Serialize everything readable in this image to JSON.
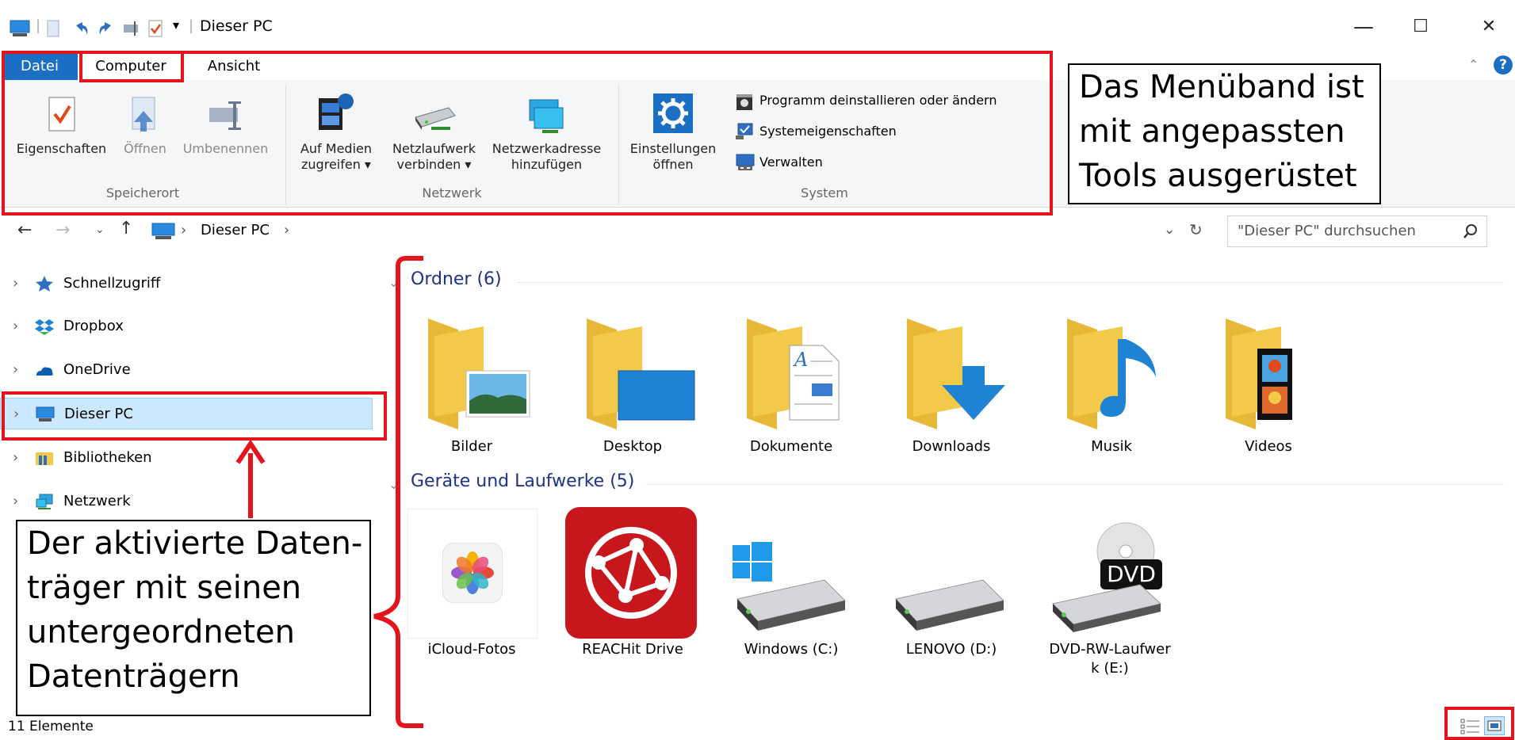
{
  "window": {
    "title": "Dieser PC",
    "minimize": "—",
    "maximize": "☐",
    "close": "✕"
  },
  "tabs": {
    "datei": "Datei",
    "computer": "Computer",
    "ansicht": "Ansicht"
  },
  "ribbon": {
    "speicherort": {
      "group_label": "Speicherort",
      "eigenschaften": "Eigenschaften",
      "oeffnen": "Öffnen",
      "umbenennen": "Umbenennen"
    },
    "netzwerk": {
      "group_label": "Netzwerk",
      "auf_medien_line1": "Auf Medien",
      "auf_medien_line2": "zugreifen ▾",
      "netzlaufwerk_line1": "Netzlaufwerk",
      "netzlaufwerk_line2": "verbinden ▾",
      "netzwerkadresse_line1": "Netzwerkadresse",
      "netzwerkadresse_line2": "hinzufügen"
    },
    "system": {
      "group_label": "System",
      "einstellungen_line1": "Einstellungen",
      "einstellungen_line2": "öffnen",
      "programm": "Programm deinstallieren oder ändern",
      "systemeigenschaften": "Systemeigenschaften",
      "verwalten": "Verwalten"
    }
  },
  "address": {
    "breadcrumb_root": "Dieser PC",
    "sep1": "›",
    "sep2": "›",
    "search_placeholder": "\"Dieser PC\" durchsuchen"
  },
  "nav": {
    "items": [
      {
        "label": "Schnellzugriff"
      },
      {
        "label": "Dropbox"
      },
      {
        "label": "OneDrive"
      },
      {
        "label": "Dieser PC"
      },
      {
        "label": "Bibliotheken"
      },
      {
        "label": "Netzwerk"
      }
    ]
  },
  "content": {
    "folders_header": "Ordner (6)",
    "folders": [
      {
        "label": "Bilder"
      },
      {
        "label": "Desktop"
      },
      {
        "label": "Dokumente"
      },
      {
        "label": "Downloads"
      },
      {
        "label": "Musik"
      },
      {
        "label": "Videos"
      }
    ],
    "devices_header": "Geräte und Laufwerke (5)",
    "devices": [
      {
        "label": "iCloud-Fotos"
      },
      {
        "label": "REACHit Drive"
      },
      {
        "label": "Windows (C:)"
      },
      {
        "label": "LENOVO (D:)"
      },
      {
        "label": "DVD-RW-Laufwer",
        "label2": "k (E:)"
      }
    ],
    "dvd_badge": "DVD"
  },
  "status": {
    "count": "11 Elemente"
  },
  "annotations": {
    "ribbon_callout": [
      "Das Menüband ist",
      "mit angepassten",
      "Tools ausgerüstet"
    ],
    "nav_callout": [
      "Der aktivierte Daten-",
      "träger mit seinen",
      "untergeordneten",
      "Datenträgern"
    ]
  },
  "colors": {
    "accent": "#1a6fc4",
    "annotation_red": "#e3141b",
    "selection": "#cce8ff",
    "folder_yellow": "#f3c94a",
    "section_blue": "#1e3287"
  }
}
